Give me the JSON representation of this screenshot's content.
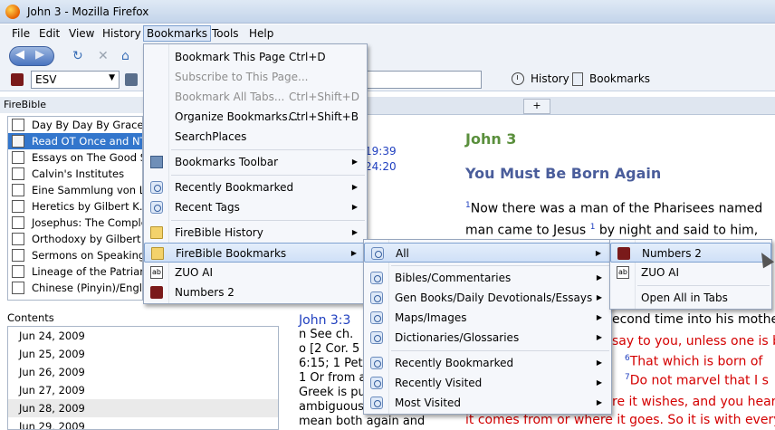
{
  "window": {
    "title": "John 3 - Mozilla Firefox"
  },
  "menubar": [
    "File",
    "Edit",
    "View",
    "History",
    "Bookmarks",
    "Tools",
    "Help"
  ],
  "toolbar": {
    "version": "ESV",
    "history_label": "History",
    "bookmarks_label": "Bookmarks"
  },
  "sidebar": {
    "title": "FireBible",
    "items": [
      "Day By Day By Grace - I",
      "Read OT Once and NT",
      "Essays on The Good Sa",
      "Calvin's Institutes",
      "Eine Sammlung von Lu",
      "Heretics by Gilbert K. C",
      "Josephus: The Complet",
      "Orthodoxy by Gilbert K",
      "Sermons on Speaking Th",
      "Lineage of the Patriarch",
      "Chinese (Pinyin)/Englis"
    ],
    "contents_label": "Contents",
    "contents": [
      "Jun 24, 2009",
      "Jun 25, 2009",
      "Jun 26, 2009",
      "Jun 27, 2009",
      "Jun 28, 2009",
      "Jun 29, 2009"
    ]
  },
  "main": {
    "refs": [
      "19:39",
      "24:20"
    ],
    "passage_title": "John 3",
    "heading": "You Must Be Born Again",
    "lines": [
      "Now there was a man of the Pharisees named",
      "man came to Jesus",
      "by night and said to him,",
      "econd time into his mothe",
      "say to you, unless one is b",
      "That which is born of",
      "Do not marvel that I s",
      "re it wishes, and you hear",
      "it comes from or where it goes. So it is with everyo"
    ],
    "verse_numbers": [
      "1",
      "1",
      "6",
      "7"
    ],
    "notes": {
      "ref": "John 3:3",
      "lines": [
        "n See ch.",
        "o [2 Cor. 5",
        "6:15; 1 Pet",
        "1 Or from a",
        "Greek is pu",
        "ambiguous",
        "mean both again and"
      ]
    }
  },
  "bookmarks_menu": {
    "items": [
      {
        "label": "Bookmark This Page",
        "shortcut": "Ctrl+D",
        "enabled": true
      },
      {
        "label": "Subscribe to This Page...",
        "shortcut": "",
        "enabled": false
      },
      {
        "label": "Bookmark All Tabs...",
        "shortcut": "Ctrl+Shift+D",
        "enabled": false
      },
      {
        "label": "Organize Bookmarks...",
        "shortcut": "Ctrl+Shift+B",
        "enabled": true
      },
      {
        "label": "SearchPlaces",
        "shortcut": "",
        "enabled": true
      },
      {
        "label": "Bookmarks Toolbar",
        "shortcut": "",
        "enabled": true
      },
      {
        "label": "Recently Bookmarked",
        "shortcut": "",
        "enabled": true
      },
      {
        "label": "Recent Tags",
        "shortcut": "",
        "enabled": true
      },
      {
        "label": "FireBible History",
        "shortcut": "",
        "enabled": true
      },
      {
        "label": "FireBible Bookmarks",
        "shortcut": "",
        "enabled": true
      },
      {
        "label": "ZUO AI",
        "shortcut": "",
        "enabled": true
      },
      {
        "label": "Numbers 2",
        "shortcut": "",
        "enabled": true
      }
    ]
  },
  "firebible_submenu": {
    "items": [
      "All",
      "Bibles/Commentaries",
      "Gen Books/Daily Devotionals/Essays",
      "Maps/Images",
      "Dictionaries/Glossaries",
      "Recently Bookmarked",
      "Recently Visited",
      "Most Visited"
    ]
  },
  "all_submenu": {
    "items": [
      "Numbers 2",
      "ZUO AI",
      "Open All in Tabs"
    ]
  }
}
